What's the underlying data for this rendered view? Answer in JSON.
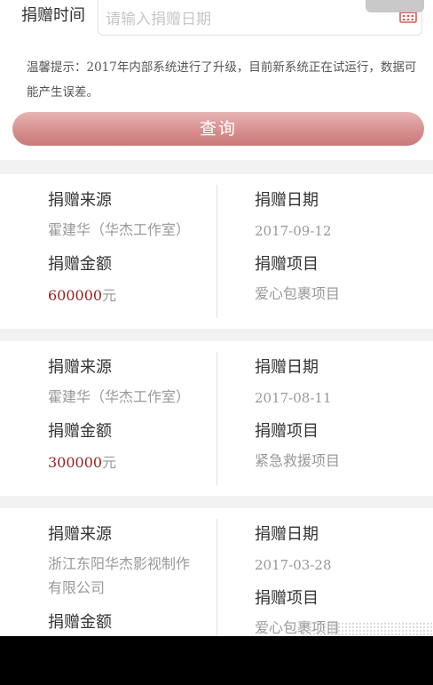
{
  "search": {
    "label": "捐赠时间",
    "placeholder": "请输入捐赠日期",
    "calendar_icon": "calendar-icon"
  },
  "tip": "温馨提示：2017年内部系统进行了升级，目前新系统正在试运行，数据可能产生误差。",
  "query_button": "查询",
  "labels": {
    "source": "捐赠来源",
    "date": "捐赠日期",
    "amount": "捐赠金额",
    "project": "捐赠项目",
    "currency_unit": "元"
  },
  "records": [
    {
      "source": "霍建华（华杰工作室）",
      "date": "2017-09-12",
      "amount": "600000",
      "project": "爱心包裹项目"
    },
    {
      "source": "霍建华（华杰工作室）",
      "date": "2017-08-11",
      "amount": "300000",
      "project": "紧急救援项目"
    },
    {
      "source_line1": "浙江东阳华杰影视制作",
      "source_line2": "有限公司",
      "date": "2017-03-28",
      "project": "爱心包裹项目"
    }
  ],
  "colors": {
    "amount": "#9b1f1f",
    "button": "#d88f8f",
    "page_bg": "#f2f2f2"
  }
}
